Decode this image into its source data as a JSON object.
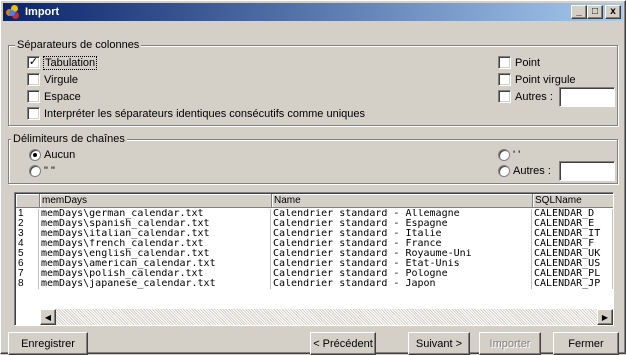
{
  "window": {
    "title": "Import"
  },
  "titlebar_buttons": {
    "minimize": "_",
    "maximize": "□",
    "close": "x"
  },
  "column_separators": {
    "legend": "Séparateurs de colonnes",
    "tab": {
      "label": "Tabulation",
      "checked": true
    },
    "comma": {
      "label": "Virgule",
      "checked": false
    },
    "space": {
      "label": "Espace",
      "checked": false
    },
    "consecutive": {
      "label": "Interpréter les séparateurs identiques consécutifs comme uniques",
      "checked": false
    },
    "period": {
      "label": "Point",
      "checked": false
    },
    "semicolon": {
      "label": "Point virgule",
      "checked": false
    },
    "other": {
      "label": "Autres :",
      "checked": false,
      "value": ""
    }
  },
  "string_delimiters": {
    "legend": "Délimiteurs de chaînes",
    "none": {
      "label": "Aucun",
      "selected": true
    },
    "double_quote": {
      "label": "\" \"",
      "selected": false
    },
    "single_quote": {
      "label": "' '",
      "selected": false
    },
    "other": {
      "label": "Autres :",
      "selected": false,
      "value": ""
    }
  },
  "grid": {
    "columns": [
      "memDays",
      "Name",
      "SQLName"
    ],
    "rows": [
      {
        "num": "1",
        "memDays": "memDays\\german_calendar.txt",
        "name": "Calendrier standard - Allemagne",
        "sqlname": "CALENDAR_D"
      },
      {
        "num": "2",
        "memDays": "memDays\\spanish_calendar.txt",
        "name": "Calendrier standard - Espagne",
        "sqlname": "CALENDAR_E"
      },
      {
        "num": "3",
        "memDays": "memDays\\italian_calendar.txt",
        "name": "Calendrier standard - Italie",
        "sqlname": "CALENDAR_IT"
      },
      {
        "num": "4",
        "memDays": "memDays\\french_calendar.txt",
        "name": "Calendrier standard - France",
        "sqlname": "CALENDAR_F"
      },
      {
        "num": "5",
        "memDays": "memDays\\english_calendar.txt",
        "name": "Calendrier standard - Royaume-Uni",
        "sqlname": "CALENDAR_UK"
      },
      {
        "num": "6",
        "memDays": "memDays\\american_calendar.txt",
        "name": "Calendrier standard - Etat-Unis",
        "sqlname": "CALENDAR_US"
      },
      {
        "num": "7",
        "memDays": "memDays\\polish_calendar.txt",
        "name": "Calendrier standard - Pologne",
        "sqlname": "CALENDAR_PL"
      },
      {
        "num": "8",
        "memDays": "memDays\\japanese_calendar.txt",
        "name": "Calendrier standard - Japon",
        "sqlname": "CALENDAR_JP"
      }
    ]
  },
  "buttons": {
    "save": "Enregistrer",
    "previous": "< Précédent",
    "next": "Suivant >",
    "import": "Importer",
    "close": "Fermer"
  },
  "icons": {
    "scroll_left": "◀",
    "scroll_right": "▶"
  }
}
